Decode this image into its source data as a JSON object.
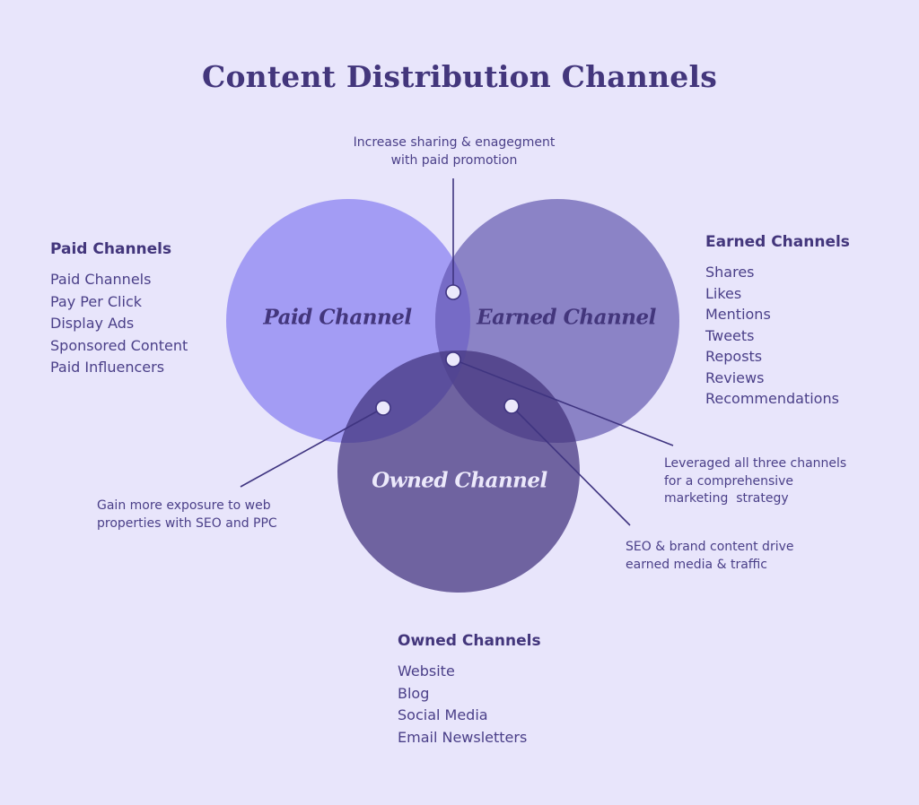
{
  "title": "Content Distribution Channels",
  "colors": {
    "background": "#e8e5fb",
    "paid": "#a39cf4",
    "earned": "#8b83c6",
    "owned": "#6f63a0",
    "text": "#43367c",
    "line": "#3f3480"
  },
  "circles": {
    "paid": "Paid Channel",
    "earned": "Earned Channel",
    "owned": "Owned Channel"
  },
  "groups": {
    "paid": {
      "heading": "Paid Channels",
      "items": [
        "Paid Channels",
        "Pay Per Click",
        "Display Ads",
        "Sponsored Content",
        "Paid Influencers"
      ]
    },
    "earned": {
      "heading": "Earned Channels",
      "items": [
        "Shares",
        "Likes",
        "Mentions",
        "Tweets",
        "Reposts",
        "Reviews",
        "Recommendations"
      ]
    },
    "owned": {
      "heading": "Owned Channels",
      "items": [
        "Website",
        "Blog",
        "Social Media",
        "Email Newsletters"
      ]
    }
  },
  "annotations": {
    "paid_earned": [
      "Increase sharing & enagegment",
      "with paid promotion"
    ],
    "paid_owned": [
      "Gain more exposure to web",
      "properties with SEO and PPC"
    ],
    "all_three": [
      "Leveraged all three channels",
      "for a comprehensive",
      "marketing  strategy"
    ],
    "earned_owned": [
      "SEO & brand content drive",
      "earned media & traffic"
    ]
  }
}
